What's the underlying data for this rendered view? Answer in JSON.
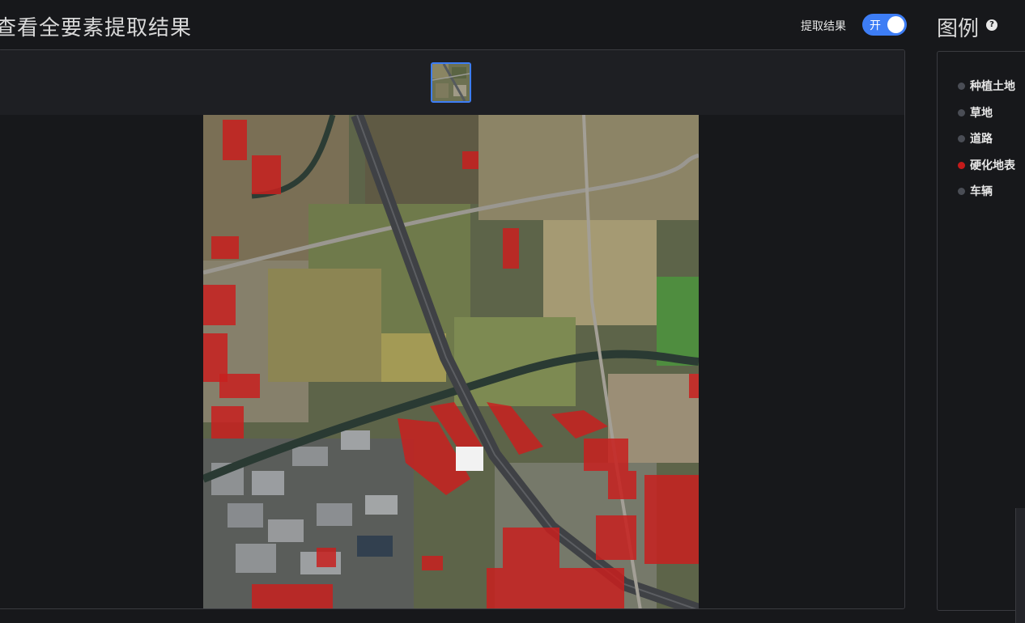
{
  "header": {
    "title": "查看全要素提取结果",
    "toggle_label": "提取结果",
    "toggle_state": "开"
  },
  "legend": {
    "title": "图例",
    "help_icon": "question-circle-icon",
    "items": [
      {
        "label": "种植土地",
        "color": "#4a4d55"
      },
      {
        "label": "草地",
        "color": "#4a4d55"
      },
      {
        "label": "道路",
        "color": "#4a4d55"
      },
      {
        "label": "硬化地表",
        "color": "#c41a1a"
      },
      {
        "label": "车辆",
        "color": "#4a4d55"
      }
    ]
  },
  "colors": {
    "accent": "#3d7df5",
    "highlight_overlay": "#c8201e"
  }
}
